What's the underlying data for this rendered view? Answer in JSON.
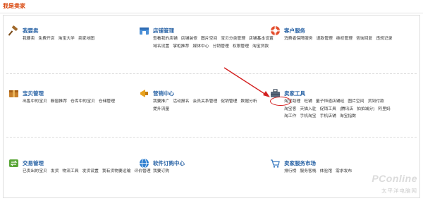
{
  "page": {
    "title": "我是卖家"
  },
  "sections": [
    {
      "key": "buy",
      "title": "我要卖",
      "icon": "gavel-icon",
      "links": [
        "我要卖",
        "免费开店",
        "淘宝大学",
        "卖家地图"
      ]
    },
    {
      "key": "shop",
      "title": "店铺管理",
      "icon": "shop-icon",
      "links": [
        "查看我的店铺",
        "店铺装修",
        "图片空间",
        "宝贝分类管理",
        "店铺基本设置",
        "域名设置",
        "掌柜推荐",
        "媒体中心",
        "分销管理",
        "权限管理",
        "淘宝贷款"
      ]
    },
    {
      "key": "service",
      "title": "客户服务",
      "icon": "lifebuoy-icon",
      "links": [
        "消费者保障服务",
        "退款管理",
        "维权管理",
        "咨询回复",
        "违规记录"
      ]
    },
    {
      "key": "items",
      "title": "宝贝管理",
      "icon": "box-icon",
      "links": [
        "出售中的宝贝",
        "橱窗推荐",
        "仓库中的宝贝",
        "仓储管理"
      ]
    },
    {
      "key": "marketing",
      "title": "营销中心",
      "icon": "megaphone-icon",
      "links": [
        "我要推广",
        "活动报名",
        "会员关系管理",
        "促销管理",
        "数据分析",
        "提升流量"
      ]
    },
    {
      "key": "tools",
      "title": "卖家工具",
      "icon": "toolbox-icon",
      "links": [
        "淘宝助理",
        "旺铺",
        "量子恒道店铺经",
        "图片空间",
        "货到付款",
        "淘宝客",
        "天猫入驻",
        "促销工具",
        "(腾讯店",
        "拍拍减分)",
        "阿里妈",
        "淘工作",
        "手机淘宝",
        "手机店铺",
        "淘宝指数"
      ]
    },
    {
      "key": "trade",
      "title": "交易管理",
      "icon": "exchange-icon",
      "links": [
        "已卖出的宝贝",
        "发货",
        "物流工具",
        "发货设置",
        "我有货物要运输",
        "评价管理"
      ]
    },
    {
      "key": "software",
      "title": "软件订购中心",
      "icon": "globe-icon",
      "links": [
        "我要订购"
      ]
    },
    {
      "key": "market",
      "title": "卖家服务市场",
      "icon": "cart-icon",
      "links": [
        "排行榜",
        "服务客栈",
        "体验馆",
        "需求发布"
      ]
    }
  ],
  "watermark": {
    "logo": "PConline",
    "sub": "太平洋电脑网"
  },
  "colors": {
    "accent": "#d9480f",
    "title": "#2a64a6",
    "highlight": "#d32020"
  }
}
